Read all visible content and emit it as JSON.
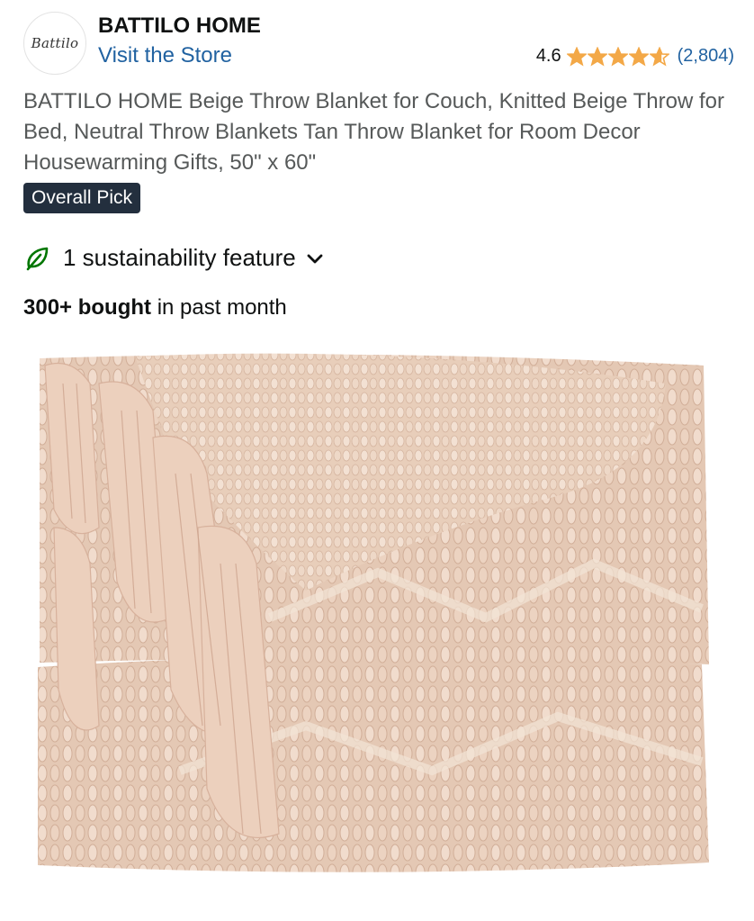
{
  "brand": {
    "logo_text": "Battilo",
    "name": "BATTILO HOME",
    "store_link": "Visit the Store"
  },
  "rating": {
    "value": "4.6",
    "stars": 4.6,
    "count": "(2,804)",
    "star_color": "#f3a847"
  },
  "product": {
    "title": "BATTILO HOME Beige Throw Blanket for Couch, Knitted Beige Throw for Bed, Neutral Throw Blankets Tan Throw Blanket for Room Decor Housewarming Gifts, 50\" x 60\"",
    "badge": "Overall Pick",
    "sustainability": "1 sustainability feature",
    "bought_bold": "300+ bought",
    "bought_rest": " in past month",
    "image_icon": "folded-knit-blanket-image"
  },
  "colors": {
    "link": "#2162a1",
    "badge_bg": "#232f3e",
    "leaf": "#007600",
    "blanket": "#e6cbb8"
  }
}
